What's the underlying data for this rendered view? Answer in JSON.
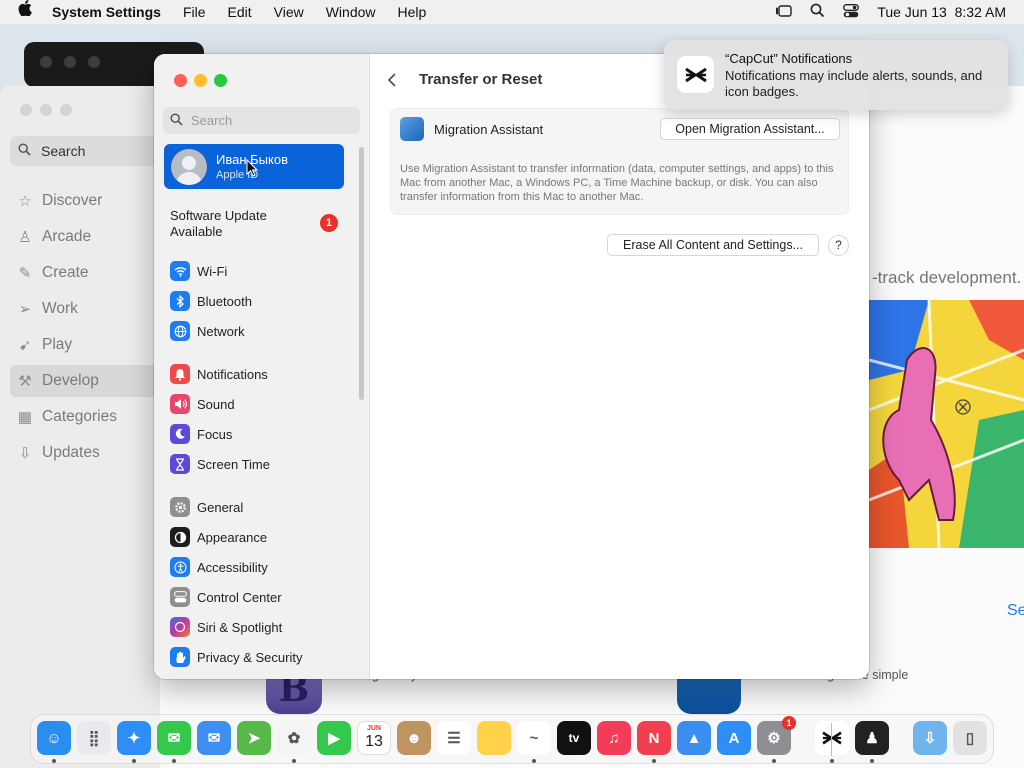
{
  "menubar": {
    "apple_icon": "apple-logo-icon",
    "app_name": "System Settings",
    "menus": [
      "File",
      "Edit",
      "View",
      "Window",
      "Help"
    ],
    "datetime": "Tue Jun 13  8:32 AM",
    "status_icons": [
      "stage-manager-icon",
      "spotlight-icon",
      "control-center-icon"
    ]
  },
  "appstore": {
    "search_placeholder": "Search",
    "nav": [
      {
        "label": "Discover",
        "icon": "star-icon"
      },
      {
        "label": "Arcade",
        "icon": "joystick-icon"
      },
      {
        "label": "Create",
        "icon": "brush-icon"
      },
      {
        "label": "Work",
        "icon": "paper-plane-icon"
      },
      {
        "label": "Play",
        "icon": "rocket-icon"
      },
      {
        "label": "Develop",
        "icon": "hammer-icon",
        "selected": true
      },
      {
        "label": "Categories",
        "icon": "grid-icon"
      },
      {
        "label": "Updates",
        "icon": "download-icon"
      }
    ],
    "featured_text": "-track development.",
    "see_link": "Se",
    "bottom_caption_1": "Legendary text and code editor",
    "bottom_caption_2": "Beta testing made simple",
    "bbedit_glyph": "B"
  },
  "settings": {
    "search_placeholder": "Search",
    "user": {
      "name": "Иван Быков",
      "subtitle": "Apple ID"
    },
    "update": {
      "label_line1": "Software Update",
      "label_line2": "Available",
      "badge": "1"
    },
    "sidebar": [
      {
        "label": "Wi-Fi",
        "icon": "wifi-icon",
        "color": "#1f7cf2"
      },
      {
        "label": "Bluetooth",
        "icon": "bluetooth-icon",
        "color": "#1f7cf2"
      },
      {
        "label": "Network",
        "icon": "globe-icon",
        "color": "#1f7cf2"
      },
      {
        "label": "Notifications",
        "icon": "bell-icon",
        "color": "#ec4a4a"
      },
      {
        "label": "Sound",
        "icon": "speaker-icon",
        "color": "#e8476a"
      },
      {
        "label": "Focus",
        "icon": "moon-icon",
        "color": "#5b4ad6"
      },
      {
        "label": "Screen Time",
        "icon": "hourglass-icon",
        "color": "#5b4ad6"
      },
      {
        "label": "General",
        "icon": "gear-icon",
        "color": "#8e8e93"
      },
      {
        "label": "Appearance",
        "icon": "appearance-icon",
        "color": "#1d1d1f"
      },
      {
        "label": "Accessibility",
        "icon": "accessibility-icon",
        "color": "#1f7cf2"
      },
      {
        "label": "Control Center",
        "icon": "control-center-icon",
        "color": "#8e8e93"
      },
      {
        "label": "Siri & Spotlight",
        "icon": "siri-icon",
        "color": "#c0399b"
      },
      {
        "label": "Privacy & Security",
        "icon": "hand-icon",
        "color": "#1f7cf2"
      }
    ],
    "page_title": "Transfer or Reset",
    "migration": {
      "label": "Migration Assistant",
      "button": "Open Migration Assistant...",
      "description": "Use Migration Assistant to transfer information (data, computer settings, and apps) to this Mac from another Mac, a Windows PC, a Time Machine backup, or disk. You can also transfer information from this Mac to another Mac."
    },
    "erase_button": "Erase All Content and Settings...",
    "help_button": "?"
  },
  "notification": {
    "title": "“CapCut” Notifications",
    "body": "Notifications may include alerts, sounds, and icon badges.",
    "icon": "capcut-icon"
  },
  "dock": {
    "apps": [
      {
        "name": "Finder",
        "icon": "finder-icon",
        "color": "#2a8ef0"
      },
      {
        "name": "Launchpad",
        "icon": "launchpad-icon",
        "color": "#e9e9ee"
      },
      {
        "name": "Safari",
        "icon": "safari-icon",
        "color": "#2f8ef5"
      },
      {
        "name": "Messages",
        "icon": "messages-icon",
        "color": "#35c84d"
      },
      {
        "name": "Mail",
        "icon": "mail-icon",
        "color": "#3d8ff1"
      },
      {
        "name": "Maps",
        "icon": "maps-icon",
        "color": "#59b84a"
      },
      {
        "name": "Photos",
        "icon": "photos-icon",
        "color": "#f4f4f4"
      },
      {
        "name": "FaceTime",
        "icon": "facetime-icon",
        "color": "#35c84d"
      },
      {
        "name": "Calendar",
        "icon": "calendar-icon",
        "color": "#ffffff",
        "month": "JUN",
        "day": "13"
      },
      {
        "name": "Contacts",
        "icon": "contacts-icon",
        "color": "#c09460"
      },
      {
        "name": "Reminders",
        "icon": "reminders-icon",
        "color": "#ffffff"
      },
      {
        "name": "Notes",
        "icon": "notes-icon",
        "color": "#ffd24a"
      },
      {
        "name": "Freeform",
        "icon": "freeform-icon",
        "color": "#ffffff"
      },
      {
        "name": "TV",
        "icon": "tv-icon",
        "color": "#111111",
        "text": "tv"
      },
      {
        "name": "Music",
        "icon": "music-icon",
        "color": "#f43c58"
      },
      {
        "name": "News",
        "icon": "news-icon",
        "color": "#f04050"
      },
      {
        "name": "Keynote",
        "icon": "keynote-icon",
        "color": "#3a8ef0"
      },
      {
        "name": "App Store",
        "icon": "appstore-icon",
        "color": "#2f8ef5"
      },
      {
        "name": "System Settings",
        "icon": "settings-gear-icon",
        "color": "#8e8e93",
        "badge": "1"
      },
      {
        "name": "CapCut",
        "icon": "capcut-icon",
        "color": "#ffffff"
      },
      {
        "name": "Tuxedo",
        "icon": "tuxedo-icon",
        "color": "#222222"
      },
      {
        "name": "Downloads",
        "icon": "downloads-folder-icon",
        "color": "#6fb5ec"
      },
      {
        "name": "Trash",
        "icon": "trash-icon",
        "color": "#e2e2e4"
      }
    ]
  }
}
